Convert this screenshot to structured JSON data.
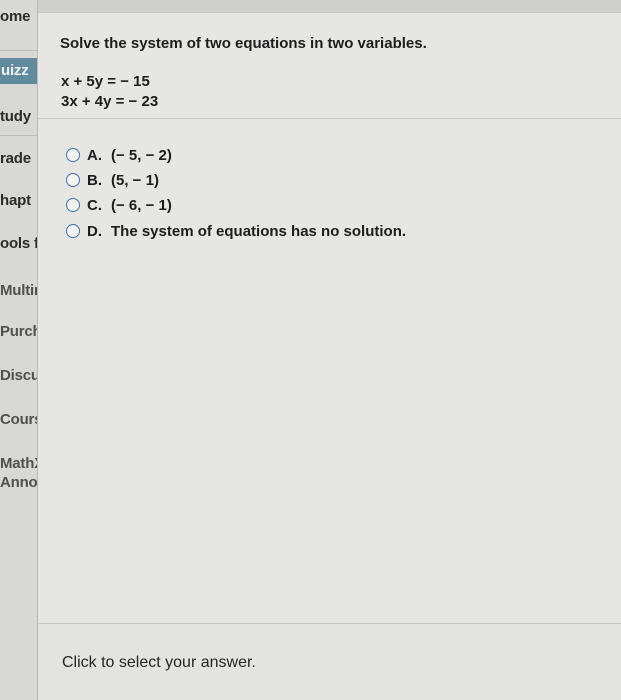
{
  "sidebar": {
    "items": [
      {
        "label": "ome"
      },
      {
        "label": "uizz"
      },
      {
        "label": "tudy"
      },
      {
        "label": "rade"
      },
      {
        "label": "hapt"
      },
      {
        "label": "ools f"
      },
      {
        "label": "Multim"
      },
      {
        "label": "Purcha"
      },
      {
        "label": "Discus"
      },
      {
        "label": "Course"
      },
      {
        "label": "MathX"
      },
      {
        "label": "Annou"
      }
    ]
  },
  "question": {
    "prompt": "Solve the system of two equations in two variables.",
    "equations": [
      "x + 5y = − 15",
      "3x + 4y = − 23"
    ],
    "options": [
      {
        "letter": "A.",
        "text": "(− 5, − 2)"
      },
      {
        "letter": "B.",
        "text": "(5, − 1)"
      },
      {
        "letter": "C.",
        "text": "(− 6, − 1)"
      },
      {
        "letter": "D.",
        "text": "The system of equations has no solution."
      }
    ]
  },
  "footer": {
    "hint": "Click to select your answer."
  },
  "colors": {
    "active_sidebar": "#5f8b9c",
    "radio_border": "#3b74b4",
    "panel_bg": "#e6e6e3"
  }
}
